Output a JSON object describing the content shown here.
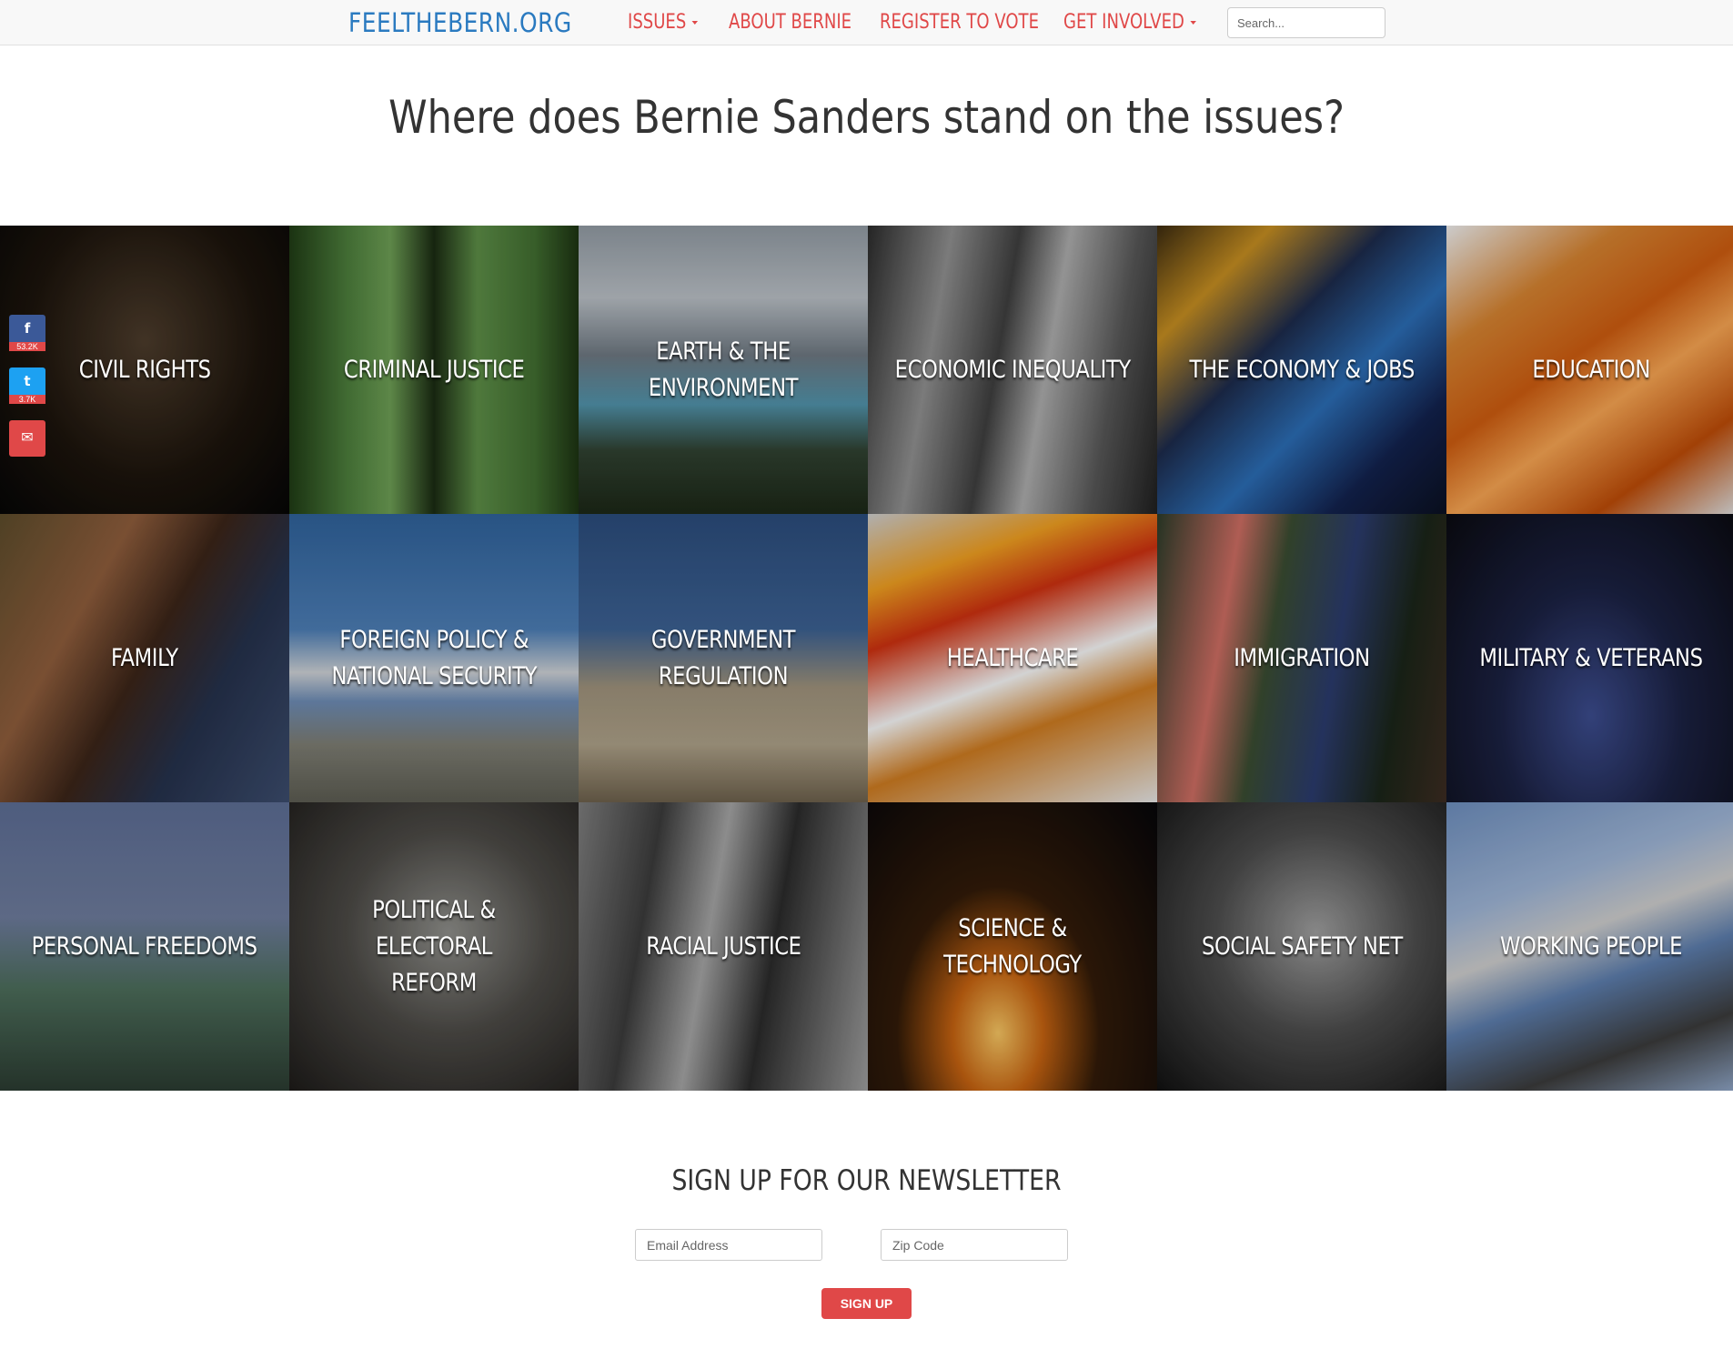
{
  "nav": {
    "brand": "FEELTHEBERN.ORG",
    "items": [
      {
        "label": "ISSUES",
        "dropdown": true
      },
      {
        "label": "ABOUT BERNIE",
        "dropdown": false
      },
      {
        "label": "REGISTER TO VOTE",
        "dropdown": false
      },
      {
        "label": "GET INVOLVED",
        "dropdown": true
      }
    ],
    "search_placeholder": "Search..."
  },
  "headline": "Where does Bernie Sanders stand on the issues?",
  "issues": [
    {
      "label": "CIVIL RIGHTS"
    },
    {
      "label": "CRIMINAL JUSTICE"
    },
    {
      "label": "EARTH & THE ENVIRONMENT"
    },
    {
      "label": "ECONOMIC INEQUALITY"
    },
    {
      "label": "THE ECONOMY & JOBS"
    },
    {
      "label": "EDUCATION"
    },
    {
      "label": "FAMILY"
    },
    {
      "label": "FOREIGN POLICY &\nNATIONAL SECURITY"
    },
    {
      "label": "GOVERNMENT REGULATION"
    },
    {
      "label": "HEALTHCARE"
    },
    {
      "label": "IMMIGRATION"
    },
    {
      "label": "MILITARY & VETERANS"
    },
    {
      "label": "PERSONAL FREEDOMS"
    },
    {
      "label": "POLITICAL & ELECTORAL\nREFORM"
    },
    {
      "label": "RACIAL JUSTICE"
    },
    {
      "label": "SCIENCE & TECHNOLOGY"
    },
    {
      "label": "SOCIAL SAFETY NET"
    },
    {
      "label": "WORKING PEOPLE"
    }
  ],
  "share": {
    "facebook": {
      "icon": "facebook-icon",
      "glyph": "f",
      "count": "53.2K",
      "color": "#3b5998"
    },
    "twitter": {
      "icon": "twitter-icon",
      "glyph": "t",
      "count": "3.7K",
      "color": "#1da1f2"
    },
    "email": {
      "icon": "envelope-icon",
      "glyph": "✉",
      "color": "#e04848"
    }
  },
  "newsletter": {
    "title": "SIGN UP FOR OUR NEWSLETTER",
    "email_placeholder": "Email Address",
    "zip_placeholder": "Zip Code",
    "button_label": "SIGN UP"
  },
  "colors": {
    "brand": "#2a7ac0",
    "accent": "#e04848",
    "headline": "#333333"
  }
}
